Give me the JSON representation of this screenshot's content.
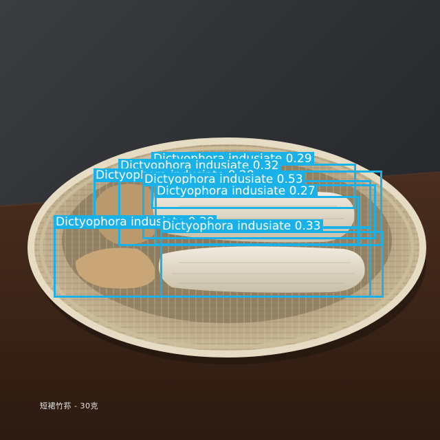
{
  "caption": "短裙竹荪 - 30克",
  "detection_color": "#1ab0e8",
  "detections": [
    {
      "label": "Dictyophora indusiate 0.29"
    },
    {
      "label": "Dictyophora indusiate 0.32"
    },
    {
      "label": "Dictyophora indusiate 0.53"
    },
    {
      "label": "Dictyophora indusiate 0.27"
    },
    {
      "label": "Dictyophora indusiate 0.33"
    },
    {
      "label": "Dictyophora indusiate 0.28"
    },
    {
      "label": "Dictyophora indusiate 0.30"
    }
  ]
}
